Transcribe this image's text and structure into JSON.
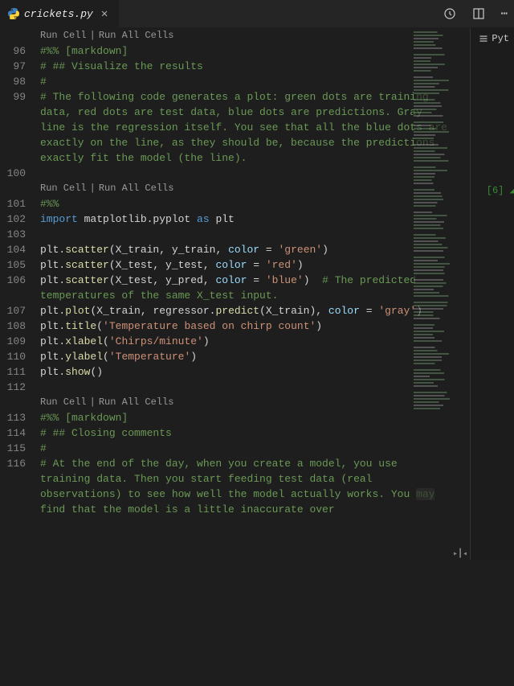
{
  "tab": {
    "filename": "crickets.py"
  },
  "codelens": {
    "run_cell": "Run Cell",
    "run_all": "Run All Cells"
  },
  "rightpanel": {
    "lang": "Pyt",
    "cell_indicator": "[6]"
  },
  "lines": [
    {
      "n": "",
      "codelens": true
    },
    {
      "n": "96",
      "tokens": [
        {
          "t": "#%%",
          "c": "tk-magic"
        },
        {
          "t": " [markdown]",
          "c": "tk-comment"
        }
      ]
    },
    {
      "n": "97",
      "tokens": [
        {
          "t": "# ## Visualize the results",
          "c": "tk-comment"
        }
      ]
    },
    {
      "n": "98",
      "tokens": [
        {
          "t": "#",
          "c": "tk-comment"
        }
      ]
    },
    {
      "n": "99",
      "tokens": [
        {
          "t": "# The following code generates a plot: green dots are training data, red dots are test data, blue dots are predictions. Gray line is the regression itself. You see that all the blue dots are exactly on the line, as they should be, because the predictions exactly fit the model (the line).",
          "c": "tk-comment"
        }
      ]
    },
    {
      "n": "100",
      "tokens": []
    },
    {
      "n": "",
      "codelens": true
    },
    {
      "n": "101",
      "tokens": [
        {
          "t": "#%%",
          "c": "tk-magic"
        }
      ]
    },
    {
      "n": "102",
      "tokens": [
        {
          "t": "import",
          "c": "tk-kw"
        },
        {
          "t": " matplotlib.pyplot ",
          "c": "tk-obj"
        },
        {
          "t": "as",
          "c": "tk-kw"
        },
        {
          "t": " plt",
          "c": "tk-obj"
        }
      ]
    },
    {
      "n": "103",
      "tokens": []
    },
    {
      "n": "104",
      "tokens": [
        {
          "t": "plt.",
          "c": "tk-obj"
        },
        {
          "t": "scatter",
          "c": "tk-fn"
        },
        {
          "t": "(X_train, y_train, ",
          "c": "tk-obj"
        },
        {
          "t": "color",
          "c": "tk-param"
        },
        {
          "t": " = ",
          "c": "tk-op"
        },
        {
          "t": "'green'",
          "c": "tk-str"
        },
        {
          "t": ")",
          "c": "tk-obj"
        }
      ]
    },
    {
      "n": "105",
      "tokens": [
        {
          "t": "plt.",
          "c": "tk-obj"
        },
        {
          "t": "scatter",
          "c": "tk-fn"
        },
        {
          "t": "(X_test, y_test, ",
          "c": "tk-obj"
        },
        {
          "t": "color",
          "c": "tk-param"
        },
        {
          "t": " = ",
          "c": "tk-op"
        },
        {
          "t": "'red'",
          "c": "tk-str"
        },
        {
          "t": ")",
          "c": "tk-obj"
        }
      ]
    },
    {
      "n": "106",
      "tokens": [
        {
          "t": "plt.",
          "c": "tk-obj"
        },
        {
          "t": "scatter",
          "c": "tk-fn"
        },
        {
          "t": "(X_test, y_pred, ",
          "c": "tk-obj"
        },
        {
          "t": "color",
          "c": "tk-param"
        },
        {
          "t": " = ",
          "c": "tk-op"
        },
        {
          "t": "'blue'",
          "c": "tk-str"
        },
        {
          "t": ")  ",
          "c": "tk-obj"
        },
        {
          "t": "# The predicted temperatures of the same X_test input.",
          "c": "tk-comment"
        }
      ]
    },
    {
      "n": "107",
      "tokens": [
        {
          "t": "plt.",
          "c": "tk-obj"
        },
        {
          "t": "plot",
          "c": "tk-fn"
        },
        {
          "t": "(X_train, regressor.",
          "c": "tk-obj"
        },
        {
          "t": "predict",
          "c": "tk-fn"
        },
        {
          "t": "(X_train), ",
          "c": "tk-obj"
        },
        {
          "t": "color",
          "c": "tk-param"
        },
        {
          "t": " = ",
          "c": "tk-op"
        },
        {
          "t": "'gray'",
          "c": "tk-str"
        },
        {
          "t": ")",
          "c": "tk-obj"
        }
      ]
    },
    {
      "n": "108",
      "tokens": [
        {
          "t": "plt.",
          "c": "tk-obj"
        },
        {
          "t": "title",
          "c": "tk-fn"
        },
        {
          "t": "(",
          "c": "tk-obj"
        },
        {
          "t": "'Temperature based on chirp count'",
          "c": "tk-str"
        },
        {
          "t": ")",
          "c": "tk-obj"
        }
      ]
    },
    {
      "n": "109",
      "tokens": [
        {
          "t": "plt.",
          "c": "tk-obj"
        },
        {
          "t": "xlabel",
          "c": "tk-fn"
        },
        {
          "t": "(",
          "c": "tk-obj"
        },
        {
          "t": "'Chirps/minute'",
          "c": "tk-str"
        },
        {
          "t": ")",
          "c": "tk-obj"
        }
      ]
    },
    {
      "n": "110",
      "tokens": [
        {
          "t": "plt.",
          "c": "tk-obj"
        },
        {
          "t": "ylabel",
          "c": "tk-fn"
        },
        {
          "t": "(",
          "c": "tk-obj"
        },
        {
          "t": "'Temperature'",
          "c": "tk-str"
        },
        {
          "t": ")",
          "c": "tk-obj"
        }
      ]
    },
    {
      "n": "111",
      "tokens": [
        {
          "t": "plt.",
          "c": "tk-obj"
        },
        {
          "t": "show",
          "c": "tk-fn"
        },
        {
          "t": "()",
          "c": "tk-obj"
        }
      ]
    },
    {
      "n": "112",
      "tokens": []
    },
    {
      "n": "",
      "codelens": true
    },
    {
      "n": "113",
      "tokens": [
        {
          "t": "#%%",
          "c": "tk-magic"
        },
        {
          "t": " [markdown]",
          "c": "tk-comment"
        }
      ]
    },
    {
      "n": "114",
      "tokens": [
        {
          "t": "# ## Closing comments",
          "c": "tk-comment"
        }
      ]
    },
    {
      "n": "115",
      "tokens": [
        {
          "t": "#",
          "c": "tk-comment"
        }
      ]
    },
    {
      "n": "116",
      "tokens": [
        {
          "t": "# At the end of the day, when you create a model, you use training data. Then you start feeding test data (real observations) to see how well the model actually works. You ",
          "c": "tk-comment"
        },
        {
          "t": "may",
          "c": "tk-comment highlight-word"
        },
        {
          "t": " find that the model is a little inaccurate over",
          "c": "tk-comment"
        }
      ]
    }
  ]
}
